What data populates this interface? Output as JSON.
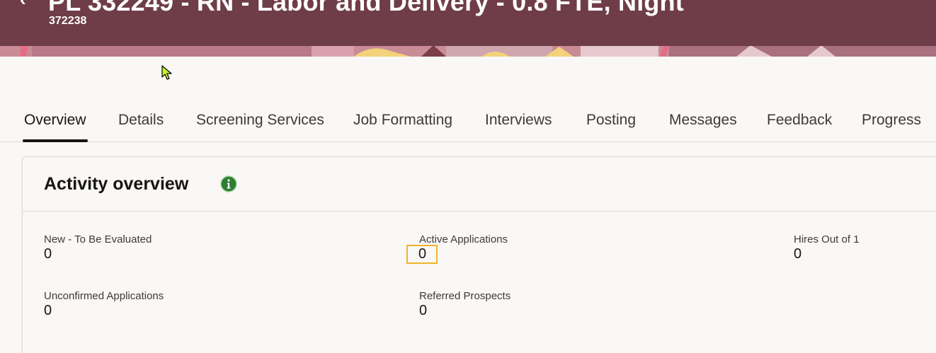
{
  "header": {
    "title": "PL 332249 - RN - Labor and Delivery - 0.8 FTE, Night",
    "job_id": "372238",
    "back_icon": "arrow-left-icon",
    "colors": {
      "banner": "#6e3d48"
    }
  },
  "tabs": [
    {
      "label": "Overview",
      "active": true
    },
    {
      "label": "Details"
    },
    {
      "label": "Screening Services"
    },
    {
      "label": "Job Formatting"
    },
    {
      "label": "Interviews"
    },
    {
      "label": "Posting"
    },
    {
      "label": "Messages"
    },
    {
      "label": "Feedback"
    },
    {
      "label": "Progress"
    }
  ],
  "activity": {
    "title": "Activity overview",
    "info_icon": "info-icon",
    "metrics": [
      {
        "label": "New - To Be Evaluated",
        "value": "0"
      },
      {
        "label": "Active Applications",
        "value": "0"
      },
      {
        "label": "Hires Out of 1",
        "value": "0"
      },
      {
        "label": "Unconfirmed Applications",
        "value": "0"
      },
      {
        "label": "Referred Prospects",
        "value": "0"
      }
    ]
  }
}
